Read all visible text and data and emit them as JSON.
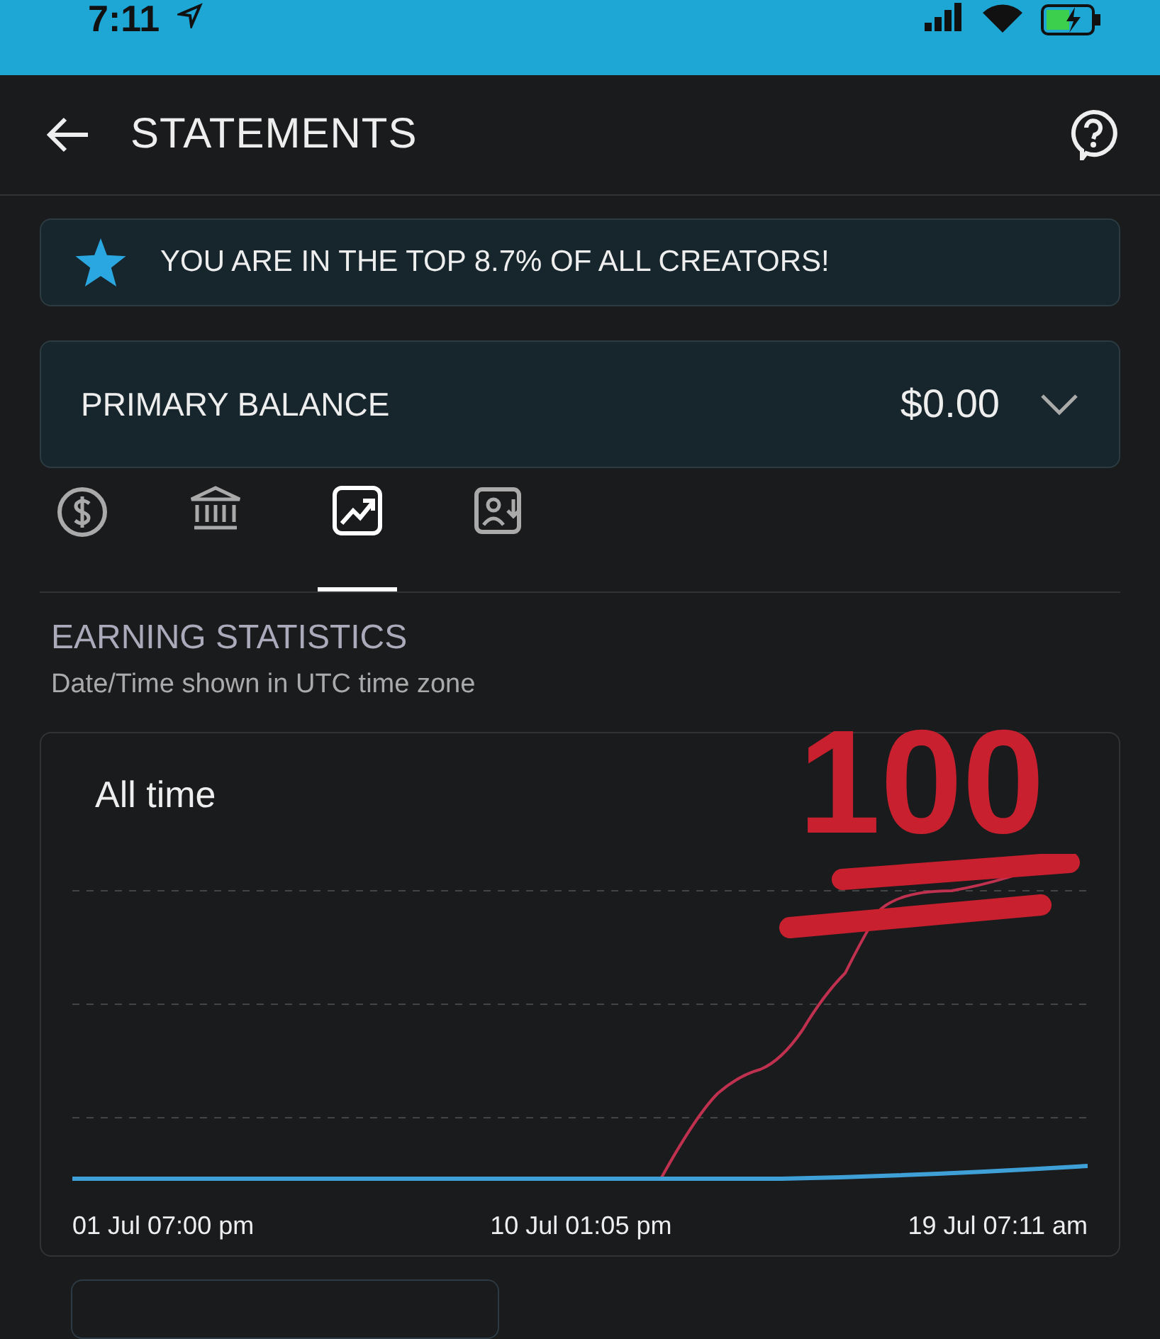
{
  "status_bar": {
    "time": "7:11"
  },
  "header": {
    "title": "STATEMENTS"
  },
  "banner": {
    "text": "YOU ARE IN THE TOP 8.7% OF ALL CREATORS!"
  },
  "balance": {
    "label": "PRIMARY BALANCE",
    "amount": "$0.00"
  },
  "tabs": [
    {
      "kind": "dollar",
      "selected": false
    },
    {
      "kind": "bank",
      "selected": false
    },
    {
      "kind": "chart",
      "selected": true
    },
    {
      "kind": "statement",
      "selected": false
    }
  ],
  "section": {
    "title": "EARNING STATISTICS",
    "subtitle": "Date/Time shown in UTC time zone"
  },
  "chart": {
    "period": "All time",
    "x_labels": [
      "01 Jul 07:00 pm",
      "10 Jul 01:05 pm",
      "19 Jul 07:11 am"
    ]
  },
  "sticker": {
    "text": "100"
  }
}
